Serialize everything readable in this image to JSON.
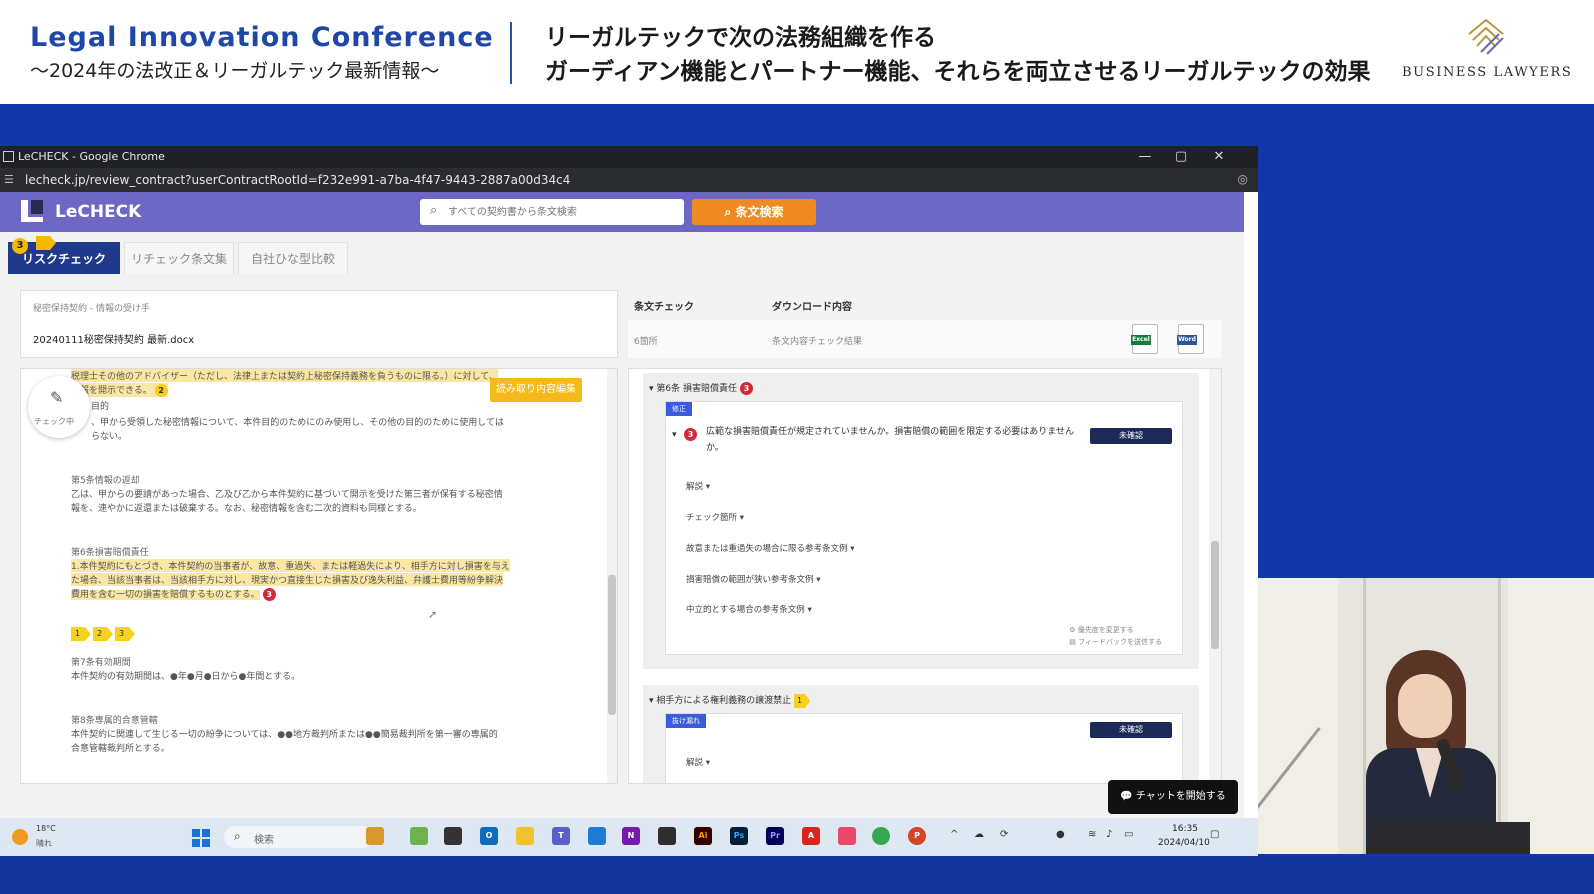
{
  "banner": {
    "conf_title": "Legal Innovation Conference",
    "conf_subtitle": "～2024年の法改正＆リーガルテック最新情報～",
    "talk_line1": "リーガルテックで次の法務組織を作る",
    "talk_line2": "ガーディアン機能とパートナー機能、それらを両立させるリーガルテックの効果",
    "sponsor": "BUSINESS LAWYERS"
  },
  "browser": {
    "window_title": "LeCHECK - Google Chrome",
    "url": "lecheck.jp/review_contract?userContractRootId=f232e991-a7ba-4f47-9443-2887a00d34c4",
    "minimize": "—",
    "maximize": "▢",
    "close": "✕"
  },
  "app": {
    "logo_text": "LeCHECK",
    "search_placeholder": "すべての契約書から条文検索",
    "search_button": "条文検索",
    "tabs": [
      {
        "label": "リスクチェック",
        "active": true
      },
      {
        "label": "リチェック条文集",
        "active": false
      },
      {
        "label": "自社ひな型比較",
        "active": false
      }
    ],
    "tab_badge": "3",
    "file": {
      "type": "秘密保持契約 - 情報の受け手",
      "name": "20240111秘密保持契約 最新.docx"
    },
    "edit_fab_label": "チェック中",
    "read_button": "読み取り内容編集",
    "document": {
      "top_lines": [
        "税理士その他のアドバイザー（ただし、法律上または契約上秘密保持義務を負うものに限る。）に対して、",
        "情報を開示できる。"
      ],
      "top_pin": "2",
      "purpose_heading": "目的",
      "purpose_lines": [
        "、甲から受領した秘密情報について、本件目的のためにのみ使用し、その他の目的のために使用しては",
        "らない。"
      ],
      "art5_title": "第5条情報の返却",
      "art5_lines": [
        "乙は、甲からの要請があった場合、乙及び乙から本件契約に基づいて開示を受けた第三者が保有する秘密情",
        "報を、速やかに返還または破棄する。なお、秘密情報を含む二次的資料も同様とする。"
      ],
      "art6_title": "第6条損害賠償責任",
      "art6_lines": [
        "1.本件契約にもとづき、本件契約の当事者が、故意、重過失、または軽過失により、相手方に対し損害を与え",
        "た場合、当該当事者は、当該相手方に対し、現実かつ直接生じた損害及び逸失利益、弁護士費用等紛争解決",
        "費用を含む一切の損害を賠償するものとする。"
      ],
      "art6_pin": "3",
      "chevrons": [
        "1",
        "2",
        "3"
      ],
      "art7_title": "第7条有効期間",
      "art7_lines": [
        "本件契約の有効期間は、●年●月●日から●年間とする。"
      ],
      "art8_title": "第8条専属的合意管轄",
      "art8_lines": [
        "本件契約に関連して生じる一切の紛争については、●●地方裁判所または●●簡易裁判所を第一審の専属的",
        "合意管轄裁判所とする。"
      ]
    },
    "right_head": {
      "col1": "条文チェック",
      "col2": "ダウンロード内容"
    },
    "right_row": {
      "col1": "6箇所",
      "col2": "条文内容チェック結果",
      "excel": "Excel",
      "word": "Word"
    },
    "clauses": [
      {
        "title": "第6条 損害賠償責任",
        "count": "3",
        "tag": "修正",
        "question_num": "3",
        "question": "広範な損害賠償責任が規定されていませんか。損害賠償の範囲を限定する必要はありませんか。",
        "status": "未確認",
        "items": [
          "解説 ▾",
          "チェック箇所 ▾",
          "故意または重過失の場合に限る参考条文例 ▾",
          "損害賠償の範囲が狭い参考条文例 ▾",
          "中立的とする場合の参考条文例 ▾"
        ],
        "footer": [
          "優先度を変更する",
          "フィードバックを送信する"
        ]
      },
      {
        "title": "相手方による権利義務の譲渡禁止",
        "count": "1",
        "tag": "抜け漏れ",
        "status": "未確認",
        "items": [
          "解説 ▾"
        ]
      }
    ],
    "chat_button": "チャットを開始する"
  },
  "taskbar": {
    "temp": "18°C",
    "weather": "晴れ",
    "search_label": "検索",
    "time": "16:35",
    "date": "2024/04/10"
  }
}
